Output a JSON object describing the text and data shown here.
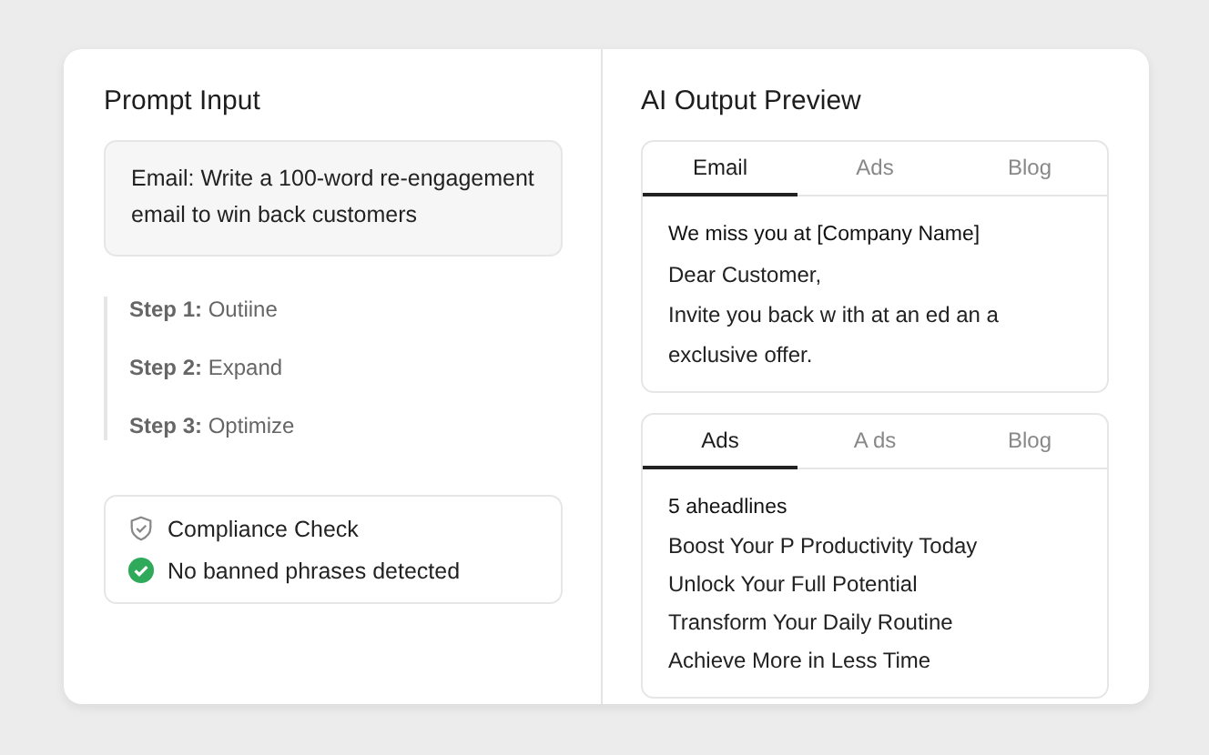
{
  "prompt_panel": {
    "title": "Prompt Input",
    "prompt": "Email:  Write a 100-word re-engagement email to win back customers",
    "steps": [
      "**Step 1:** Outiine",
      "**Step 2:** Expand",
      "**Step 3:** Optimize"
    ],
    "compliance": {
      "title": "Compliance Check",
      "result": "No banned phrases detected",
      "passed": true
    }
  },
  "preview_panel": {
    "title": "AI Output Preview",
    "cards": [
      {
        "tabs": [
          {
            "label": "Email",
            "selected": true
          },
          {
            "label": "Ads",
            "selected": false
          },
          {
            "label": "Blog",
            "selected": false
          }
        ],
        "heading": "We miss you at [Company Name]",
        "lines": [
          "Dear Customer,",
          "Invite you back w ith at an ed an a exclusive offer."
        ]
      },
      {
        "tabs": [
          {
            "label": "Ads",
            "selected": true
          },
          {
            "label": "A ds",
            "selected": false
          },
          {
            "label": "Blog",
            "selected": false
          }
        ],
        "heading": "5 aheadlines",
        "lines": [
          "Boost Your P Productivity Today",
          "Unlock Your Full Potential",
          "Transform Your Daily Routine",
          "Achieve More in Less Time"
        ]
      }
    ]
  }
}
